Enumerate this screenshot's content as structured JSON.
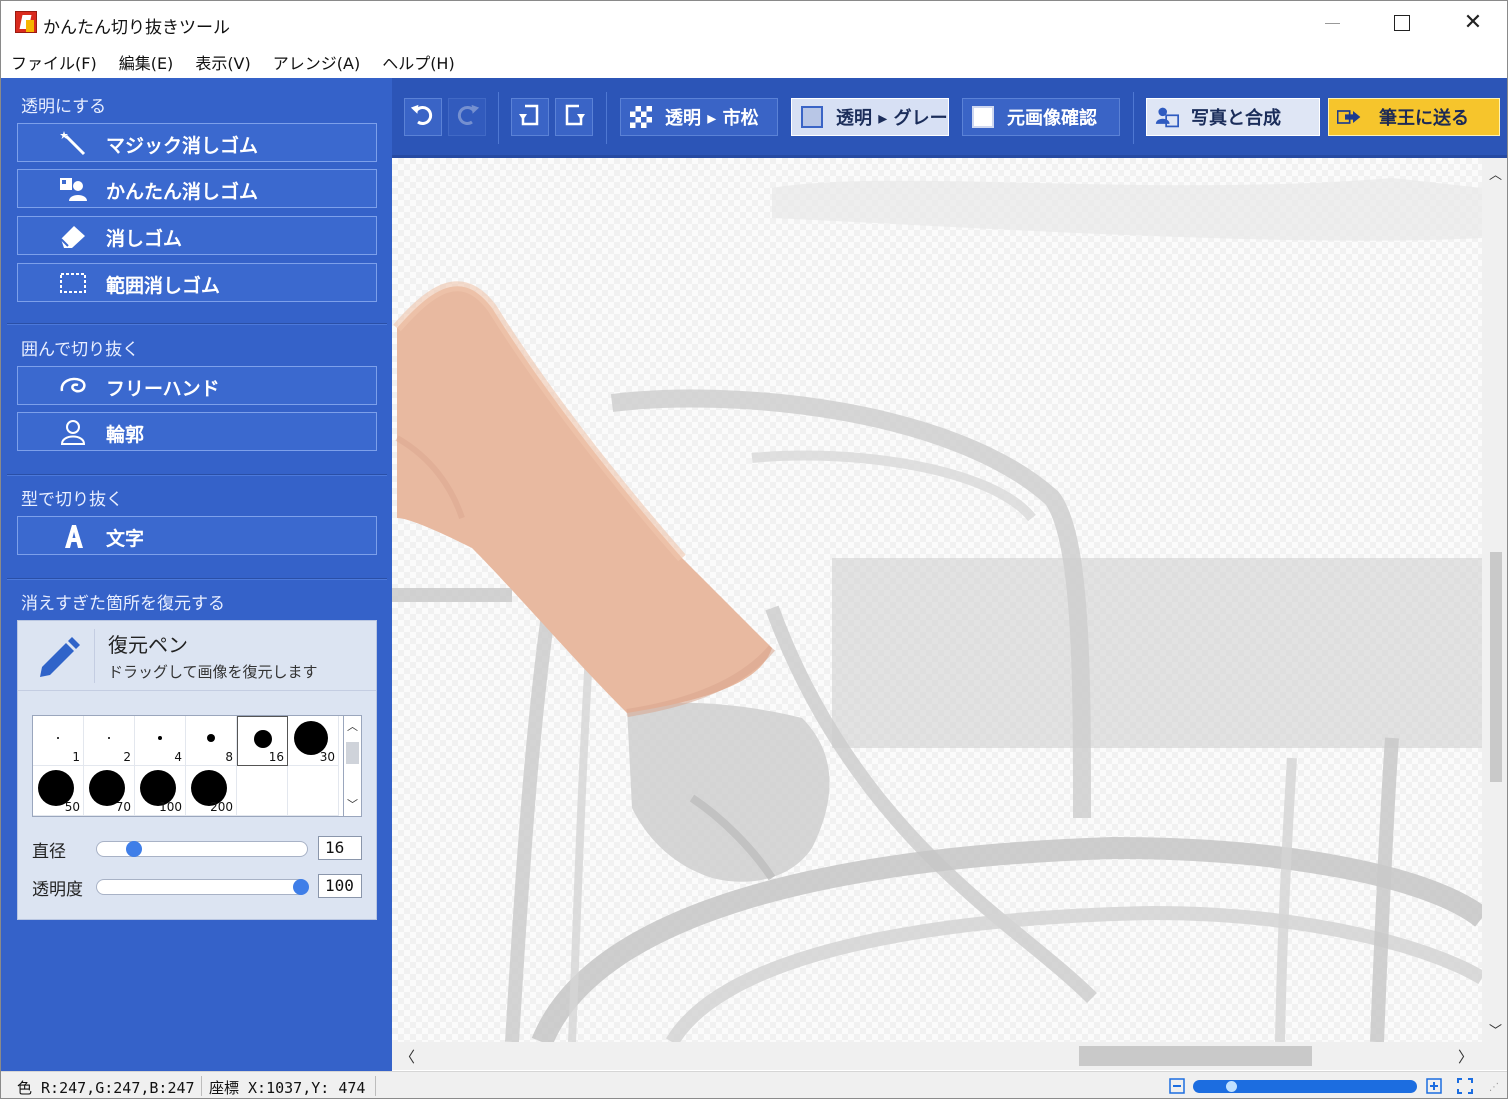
{
  "window": {
    "title": "かんたん切り抜きツール",
    "min": "",
    "max": "",
    "close": "✕"
  },
  "menu": [
    "ファイル(F)",
    "編集(E)",
    "表示(V)",
    "アレンジ(A)",
    "ヘルプ(H)"
  ],
  "sidebar": {
    "sections": [
      {
        "title": "透明にする",
        "tools": [
          {
            "label": "マジック消しゴム",
            "icon": "magic-wand-icon"
          },
          {
            "label": "かんたん消しゴム",
            "icon": "person-eraser-icon"
          },
          {
            "label": "消しゴム",
            "icon": "eraser-icon"
          },
          {
            "label": "範囲消しゴム",
            "icon": "rect-select-icon"
          }
        ]
      },
      {
        "title": "囲んで切り抜く",
        "tools": [
          {
            "label": "フリーハンド",
            "icon": "lasso-icon"
          },
          {
            "label": "輪郭",
            "icon": "person-outline-icon"
          }
        ]
      },
      {
        "title": "型で切り抜く",
        "tools": [
          {
            "label": "文字",
            "icon": "letter-a-icon"
          }
        ]
      },
      {
        "title": "消えすぎた箇所を復元する",
        "tools": []
      }
    ],
    "restore": {
      "title": "復元ペン",
      "description": "ドラッグして画像を復元します",
      "brush_sizes": [
        "1",
        "2",
        "4",
        "8",
        "16",
        "30",
        "50",
        "70",
        "100",
        "200"
      ],
      "selected_brush": "16",
      "diameter_label": "直径",
      "diameter_value": "16",
      "diameter_fraction": 0.14,
      "opacity_label": "透明度",
      "opacity_value": "100",
      "opacity_fraction": 1.0
    }
  },
  "toolbar": {
    "undo_icon": "undo-icon",
    "redo_icon": "redo-icon",
    "rotate_left_icon": "rotate-left-icon",
    "rotate_right_icon": "rotate-right-icon",
    "buttons": [
      {
        "label": "透明 ▸ 市松",
        "icon": "checker-icon",
        "style": "normal"
      },
      {
        "label": "透明 ▸ グレー",
        "icon": "gray-square-icon",
        "style": "active"
      },
      {
        "label": "元画像確認",
        "icon": "white-square-icon",
        "style": "normal"
      },
      {
        "label": "写真と合成",
        "icon": "composite-icon",
        "style": "light"
      },
      {
        "label": "筆王に送る",
        "icon": "send-arrow-icon",
        "style": "yellow"
      }
    ]
  },
  "status": {
    "color": "色 R:247,G:247,B:247",
    "coords": "座標 X:1037,Y: 474",
    "zoom_fraction": 0.15
  },
  "colors": {
    "sidebar": "#3562c9",
    "toolbar": "#2c55b7",
    "accent_yellow": "#f6c52c"
  }
}
